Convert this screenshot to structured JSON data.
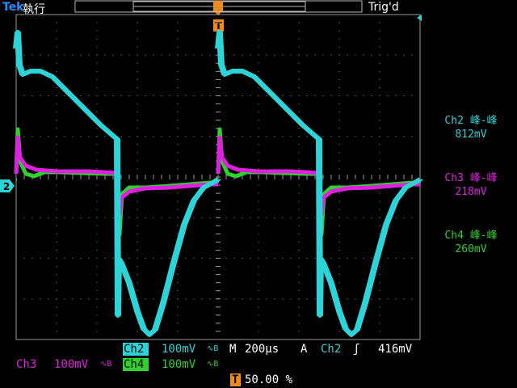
{
  "header": {
    "brand": "Tek",
    "run_status": "執行",
    "trigger_status": "Trig'd",
    "trigger_marker": "T"
  },
  "colors": {
    "ch2": "#2ed3d8",
    "ch3": "#e020e0",
    "ch4": "#30d030",
    "grid": "#9a9a9a",
    "brand": "#1e90ff",
    "trigger": "#f08a1c"
  },
  "ground_marker": "2",
  "measurements": [
    {
      "label": "Ch2 峰-峰",
      "value": "812mV",
      "color": "#2ed3d8"
    },
    {
      "label": "Ch3 峰-峰",
      "value": "218mV",
      "color": "#e020e0"
    },
    {
      "label": "Ch4 峰-峰",
      "value": "260mV",
      "color": "#30d030"
    }
  ],
  "channels": {
    "ch2": {
      "name": "Ch2",
      "scale": "100mV",
      "bw": "∿B"
    },
    "ch3": {
      "name": "Ch3",
      "scale": "100mV",
      "bw": "∿B"
    },
    "ch4": {
      "name": "Ch4",
      "scale": "100mV",
      "bw": "∿B"
    }
  },
  "timebase": {
    "prefix": "M",
    "value": "200µs"
  },
  "trigger": {
    "mode": "A",
    "source": "Ch2",
    "slope": "ʃ",
    "level": "416mV"
  },
  "trigger_position": {
    "marker": "T",
    "value": "50.00 %"
  }
}
